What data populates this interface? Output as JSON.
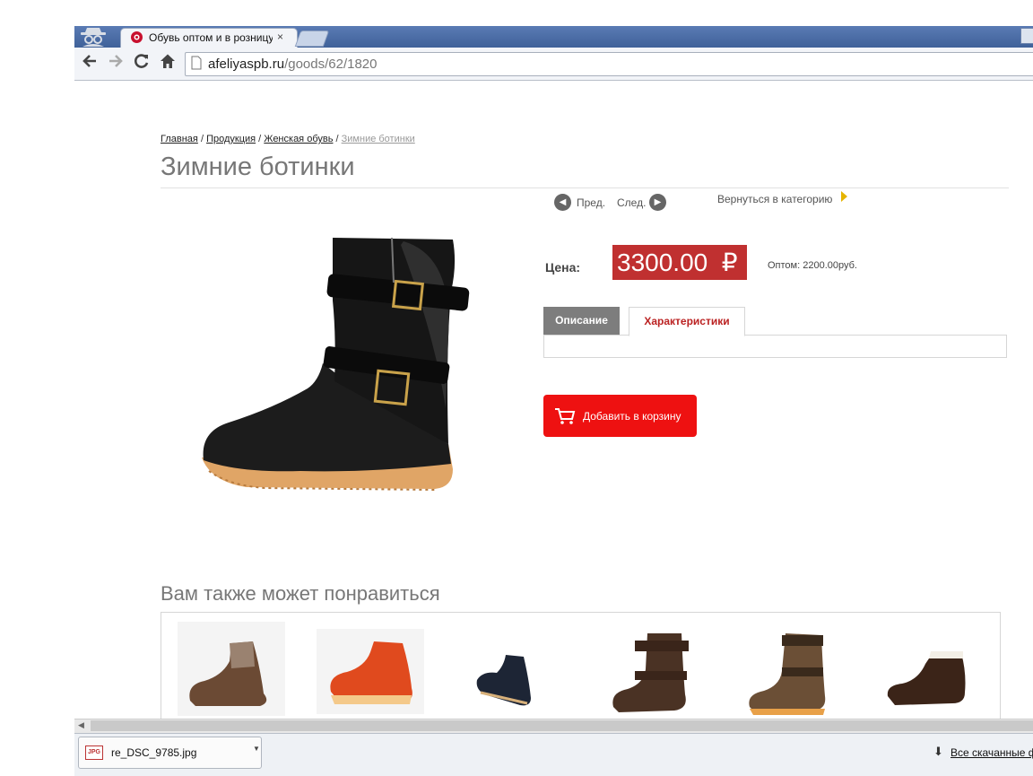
{
  "browser": {
    "tab_title": "Обувь оптом и в розницу",
    "tab_close": "×",
    "url_domain": "afeliyaspb.ru",
    "url_path": "/goods/62/1820"
  },
  "breadcrumb": {
    "items": [
      "Главная",
      "Продукция",
      "Женская обувь"
    ],
    "separator": "/",
    "current": "Зимние ботинки"
  },
  "product": {
    "title": "Зимние ботинки",
    "prev_label": "Пред.",
    "next_label": "След.",
    "back_to_category": "Вернуться в категорию",
    "price_label": "Цена:",
    "price_value": "3300.00",
    "currency_symbol": "₽",
    "wholesale_text": "Оптом: 2200.00руб.",
    "tabs": [
      "Описание",
      "Характеристики"
    ],
    "active_tab": "Характеристики",
    "add_to_cart_label": "Добавить в корзину"
  },
  "related": {
    "title": "Вам также может понравиться",
    "items": [
      "brown-lace-up-shoe",
      "orange-lace-up-boot",
      "navy-low-boot",
      "brown-buckle-boot",
      "tan-buckle-boot",
      "fur-trim-low-boot"
    ]
  },
  "downloads": {
    "file_name": "re_DSC_9785.jpg",
    "file_type": "JPG",
    "all_downloads_label": "Все скачанные файлы"
  },
  "colors": {
    "price_bg": "#c03030",
    "cart_button": "#ee1111",
    "active_tab_text": "#bb2222",
    "accent_arrow": "#e5b400"
  }
}
